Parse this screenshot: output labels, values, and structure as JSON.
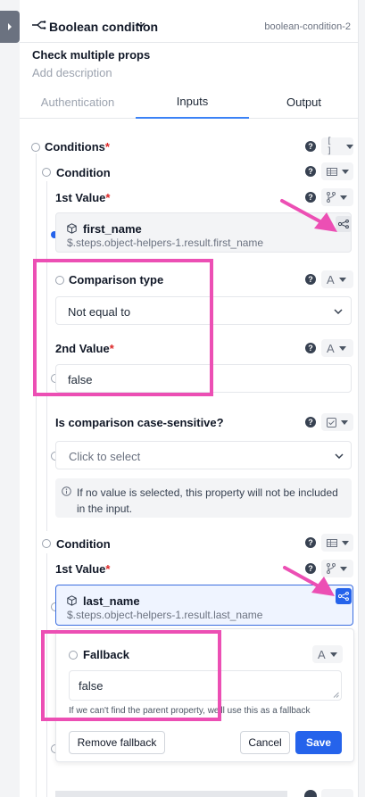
{
  "header": {
    "title": "Boolean condition",
    "step_id": "boolean-condition-2"
  },
  "step": {
    "title": "Check multiple props",
    "description_placeholder": "Add description"
  },
  "tabs": [
    "Authentication",
    "Inputs",
    "Output"
  ],
  "active_tab": "Inputs",
  "conditions": {
    "label": "Conditions",
    "required_mark": "*",
    "type_glyph": "[ ]"
  },
  "condition_1": {
    "label": "Condition",
    "first_value": {
      "label": "1st Value",
      "required_mark": "*",
      "ref_name": "first_name",
      "ref_path": "$.steps.object-helpers-1.result.first_name"
    },
    "comparison_type": {
      "label": "Comparison type",
      "type_glyph": "A",
      "value": "Not equal to"
    },
    "second_value": {
      "label": "2nd Value",
      "required_mark": "*",
      "type_glyph": "A",
      "value": "false"
    },
    "case_sensitive": {
      "label": "Is comparison case-sensitive?",
      "placeholder": "Click to select",
      "info": "If no value is selected, this property will not be included in the input."
    }
  },
  "condition_2": {
    "label": "Condition",
    "first_value": {
      "label": "1st Value",
      "required_mark": "*",
      "ref_name": "last_name",
      "ref_path": "$.steps.object-helpers-1.result.last_name"
    }
  },
  "fallback": {
    "label": "Fallback",
    "type_glyph": "A",
    "value": "false",
    "note": "If we can't find the parent property, we'll use this as a fallback",
    "remove_label": "Remove fallback",
    "cancel_label": "Cancel",
    "save_label": "Save"
  },
  "annotation_color": "#ec4fb4",
  "accent_color": "#2563eb"
}
